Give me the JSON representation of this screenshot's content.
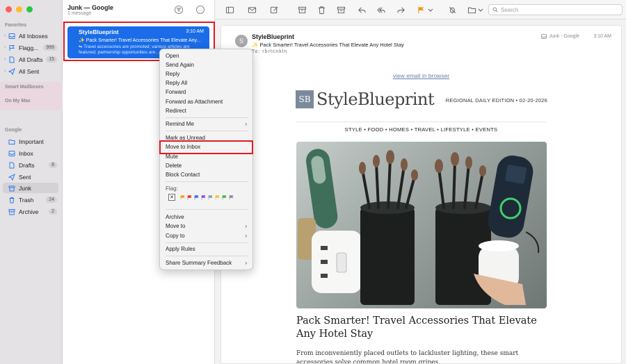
{
  "sidebar": {
    "favorites_label": "Favorites",
    "smart_label": "Smart Mailboxes",
    "onmymac_label": "On My Mac",
    "google_label": "Google",
    "favorites": [
      {
        "label": "All Inboxes",
        "count": ""
      },
      {
        "label": "Flagg...",
        "count": "999"
      },
      {
        "label": "All Drafts",
        "count": "15"
      },
      {
        "label": "All Sent",
        "count": ""
      }
    ],
    "google": [
      {
        "label": "Important",
        "count": ""
      },
      {
        "label": "Inbox",
        "count": ""
      },
      {
        "label": "Drafts",
        "count": "8"
      },
      {
        "label": "Sent",
        "count": ""
      },
      {
        "label": "Junk",
        "count": ""
      },
      {
        "label": "Trash",
        "count": "24"
      },
      {
        "label": "Archive",
        "count": "2"
      }
    ]
  },
  "list": {
    "title": "Junk — Google",
    "subtitle": "1 message",
    "message": {
      "from": "StyleBlueprint",
      "time": "3:10 AM",
      "subject": "✨ Pack Smarter! Travel Accessories That Elevate Any...",
      "preview": "Travel accessories are promoted; various articles are featured; partnership opportunities are..."
    }
  },
  "toolbar": {
    "search_placeholder": "Search"
  },
  "reader": {
    "avatar": "S",
    "from": "StyleBlueprint",
    "subject": "✨ Pack Smarter! Travel Accessories That Elevate Any Hotel Stay",
    "to_label": "To:",
    "to": "rbrtcnkln",
    "mailbox": "Junk - Google",
    "time": "3:10 AM"
  },
  "email": {
    "view_link": "view email in browser",
    "brand_mark": "SB",
    "brand_name": "StyleBlueprint",
    "edition": "REGIONAL DAILY EDITION  •  02-20-2026",
    "nav": "STYLE  •  FOOD  •  HOMES  •  TRAVEL  •  LIFESTYLE  •  EVENTS",
    "title": "Pack Smarter! Travel Accessories That Elevate Any Hotel Stay",
    "body": "From inconveniently placed outlets to lackluster lighting, these smart accessories solve common hotel room gripes."
  },
  "context_menu": {
    "items": [
      {
        "label": "Open",
        "submenu": false
      },
      {
        "label": "Send Again",
        "submenu": false
      },
      {
        "label": "Reply",
        "submenu": false
      },
      {
        "label": "Reply All",
        "submenu": false
      },
      {
        "label": "Forward",
        "submenu": false
      },
      {
        "label": "Forward as Attachment",
        "submenu": false
      },
      {
        "label": "Redirect",
        "submenu": false
      },
      {
        "label": "Remind Me",
        "submenu": true
      },
      {
        "label": "Mark as Unread",
        "submenu": false
      },
      {
        "label": "Move to Inbox",
        "submenu": false,
        "highlighted": true
      },
      {
        "label": "Mute",
        "submenu": false
      },
      {
        "label": "Delete",
        "submenu": false
      },
      {
        "label": "Block Contact",
        "submenu": false
      },
      {
        "label": "Flag:",
        "submenu": false
      },
      {
        "label": "Archive",
        "submenu": false
      },
      {
        "label": "Move to",
        "submenu": true
      },
      {
        "label": "Copy to",
        "submenu": true
      },
      {
        "label": "Apply Rules",
        "submenu": false
      },
      {
        "label": "Share Summary Feedback",
        "submenu": true
      }
    ],
    "flag_colors": [
      "#f39a1c",
      "#e8392f",
      "#3a6fe0",
      "#8e4fd6",
      "#8e9aa3",
      "#f3c62a",
      "#3fb54c",
      "#8a8a8e"
    ]
  },
  "colors": {
    "accent": "#1a6ce8",
    "highlight_box": "#e0191e"
  }
}
